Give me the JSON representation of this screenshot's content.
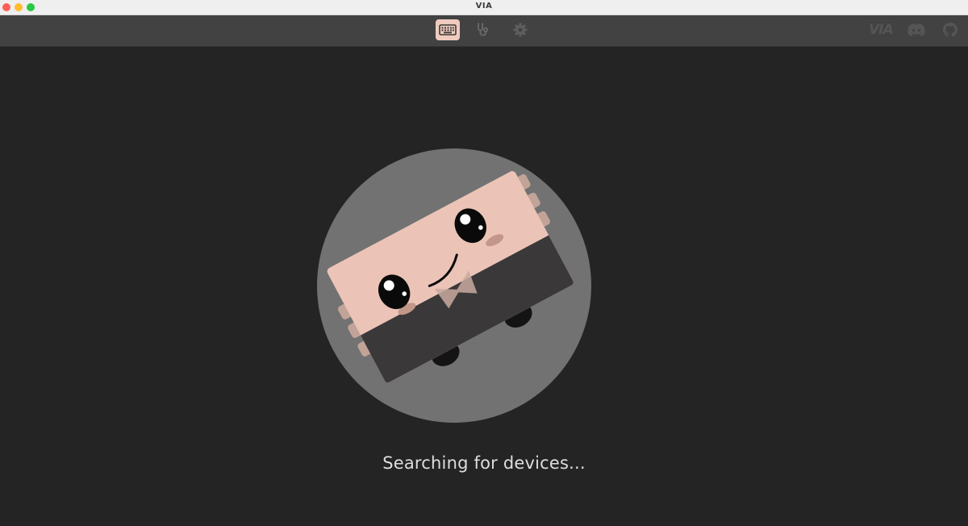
{
  "window": {
    "title": "VIA"
  },
  "toolbar": {
    "tools": [
      {
        "icon": "keyboard-icon",
        "active": true
      },
      {
        "icon": "stethoscope-icon",
        "active": false
      },
      {
        "icon": "gear-icon",
        "active": false
      }
    ],
    "external_links": [
      {
        "icon": "via-logo-icon",
        "label": "VIA"
      },
      {
        "icon": "discord-icon"
      },
      {
        "icon": "github-icon"
      }
    ]
  },
  "main": {
    "status": "Searching for devices..."
  },
  "colors": {
    "titlebar": "#efefef",
    "toolbar": "#424242",
    "background": "#242424",
    "active_tab": "#efcbbd",
    "mascot_circle": "#727272",
    "mascot_body": "#ebc4b7",
    "text": "#dedede"
  }
}
